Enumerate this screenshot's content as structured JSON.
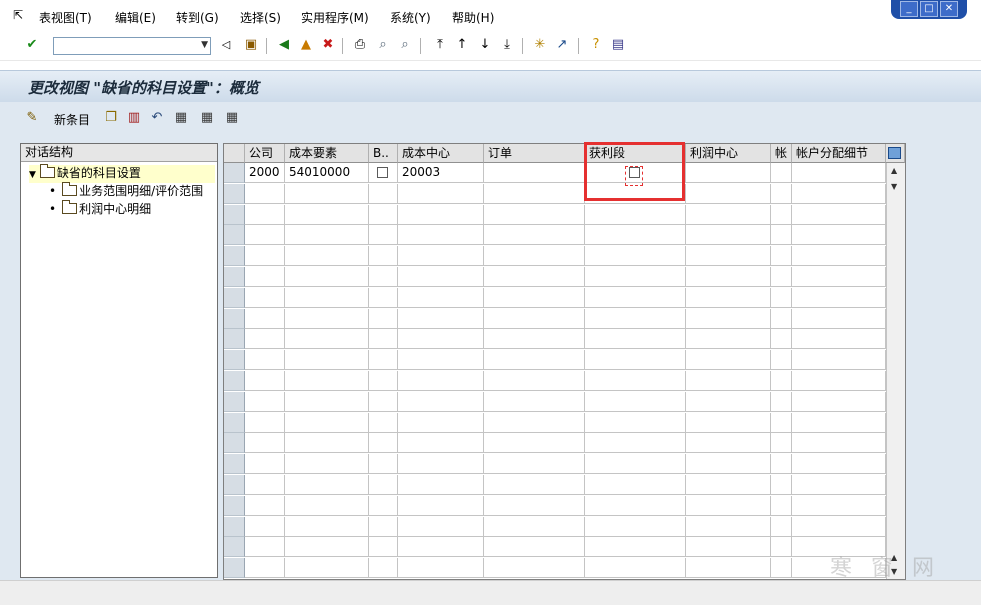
{
  "menu": {
    "items": [
      "表视图(T)",
      "编辑(E)",
      "转到(G)",
      "选择(S)",
      "实用程序(M)",
      "系统(Y)",
      "帮助(H)"
    ]
  },
  "title": "更改视图 \"缺省的科目设置\"：概览",
  "app_toolbar": {
    "new_entries_label": "新条目"
  },
  "dialog_structure": {
    "header": "对话结构",
    "root": "缺省的科目设置",
    "children": [
      "业务范围明细/评价范围",
      "利润中心明细"
    ]
  },
  "table": {
    "columns": [
      "公司",
      "成本要素",
      "B..",
      "成本中心",
      "订单",
      "获利段",
      "利润中心",
      "帐",
      "帐户分配细节"
    ],
    "rows": [
      {
        "company": "2000",
        "cost_element": "54010000",
        "business_area_check": false,
        "cost_center": "20003",
        "order": "",
        "profit_segment_check": false,
        "profit_center": "",
        "account": "",
        "acct_detail": ""
      }
    ]
  },
  "watermark": "寒 窗 网"
}
